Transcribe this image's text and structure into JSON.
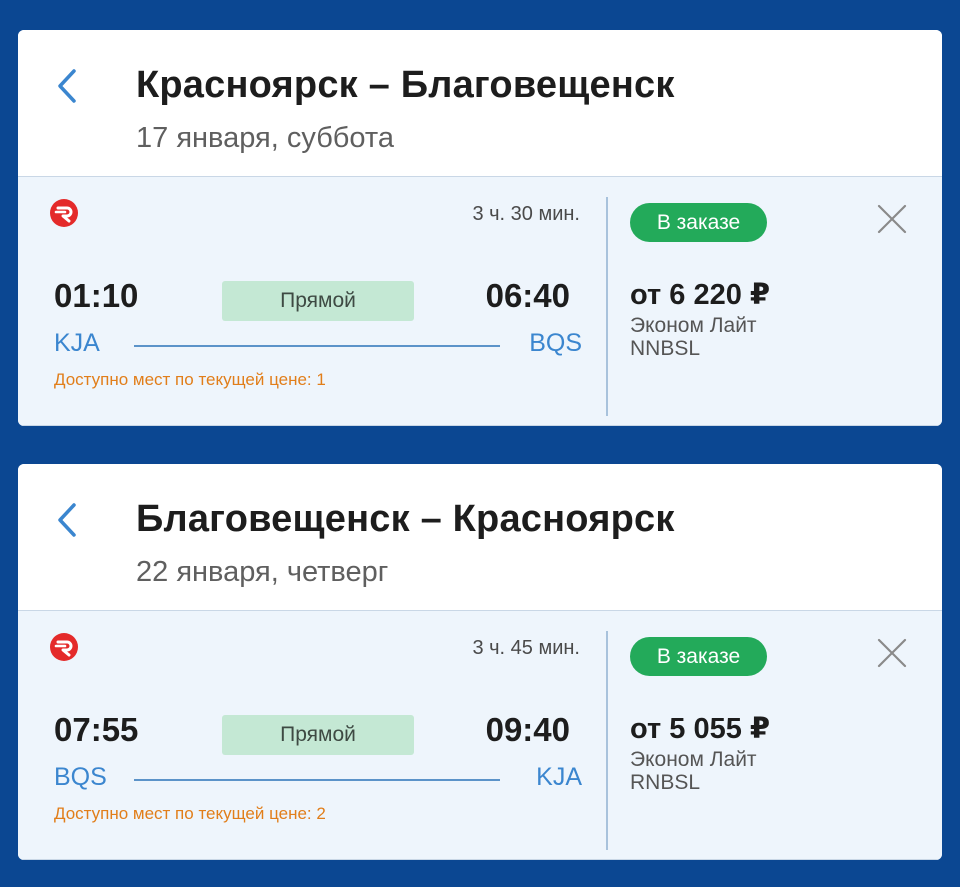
{
  "colors": {
    "background": "#0b4792",
    "accent_blue": "#3b86cf",
    "status_green": "#23aa5a",
    "direct_badge_bg": "#c4e8d4",
    "warning_orange": "#e17e1a",
    "airline_red": "#e42a2a"
  },
  "icons": {
    "back": "chevron-left-icon",
    "close": "close-x-icon",
    "airline": "airline-logo-icon"
  },
  "trips": [
    {
      "title": "Красноярск – Благовещенск",
      "date": "17 января, суббота",
      "flight": {
        "duration": "3 ч. 30 мин.",
        "departure_time": "01:10",
        "arrival_time": "06:40",
        "direct_label": "Прямой",
        "departure_code": "KJA",
        "arrival_code": "BQS",
        "seats_note": "Доступно мест по текущей цене: 1",
        "status": "В заказе",
        "price": "от 6 220 ₽",
        "fare_name": "Эконом Лайт",
        "fare_code": "NNBSL"
      }
    },
    {
      "title": "Благовещенск – Красноярск",
      "date": "22 января, четверг",
      "flight": {
        "duration": "3 ч. 45 мин.",
        "departure_time": "07:55",
        "arrival_time": "09:40",
        "direct_label": "Прямой",
        "departure_code": "BQS",
        "arrival_code": "KJA",
        "seats_note": "Доступно мест по текущей цене: 2",
        "status": "В заказе",
        "price": "от 5 055 ₽",
        "fare_name": "Эконом Лайт",
        "fare_code": "RNBSL"
      }
    }
  ]
}
